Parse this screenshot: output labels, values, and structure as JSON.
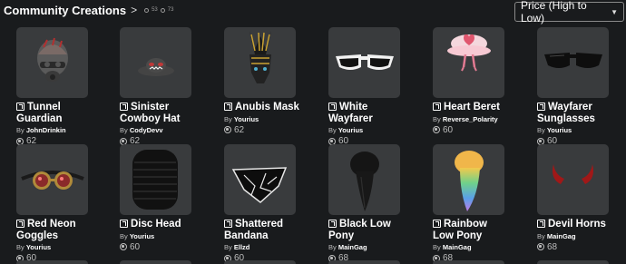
{
  "header": {
    "title": "Community Creations",
    "chevron": ">",
    "stat_a": "53",
    "stat_b": "73"
  },
  "sort": {
    "label": "Price (High to Low)"
  },
  "items": [
    {
      "name": "Tunnel Guardian",
      "by": "By",
      "creator": "JohnDrinkin",
      "price": "62",
      "icon": "gas-mask-helmet"
    },
    {
      "name": "Sinister Cowboy Hat",
      "by": "By",
      "creator": "CodyDevv",
      "price": "62",
      "icon": "cowboy-hat"
    },
    {
      "name": "Anubis Mask",
      "by": "By",
      "creator": "Yourius",
      "price": "62",
      "icon": "anubis-mask"
    },
    {
      "name": "White Wayfarer",
      "by": "By",
      "creator": "Yourius",
      "price": "60",
      "icon": "white-sunglasses"
    },
    {
      "name": "Heart Beret",
      "by": "By",
      "creator": "Reverse_Polarity",
      "price": "60",
      "icon": "heart-beret"
    },
    {
      "name": "Wayfarer Sunglasses",
      "by": "By",
      "creator": "Yourius",
      "price": "60",
      "icon": "black-sunglasses"
    },
    {
      "name": "Red Neon Goggles",
      "by": "By",
      "creator": "Yourius",
      "price": "60",
      "icon": "goggles"
    },
    {
      "name": "Disc Head",
      "by": "By",
      "creator": "Yourius",
      "price": "60",
      "icon": "disc-head"
    },
    {
      "name": "Shattered Bandana",
      "by": "By",
      "creator": "Ellzd",
      "price": "60",
      "icon": "bandana"
    },
    {
      "name": "Black Low Pony",
      "by": "By",
      "creator": "MainGag",
      "price": "68",
      "icon": "black-ponytail"
    },
    {
      "name": "Rainbow Low Pony",
      "by": "By",
      "creator": "MainGag",
      "price": "68",
      "icon": "rainbow-ponytail"
    },
    {
      "name": "Devil Horns",
      "by": "By",
      "creator": "MainGag",
      "price": "68",
      "icon": "devil-horns"
    }
  ]
}
